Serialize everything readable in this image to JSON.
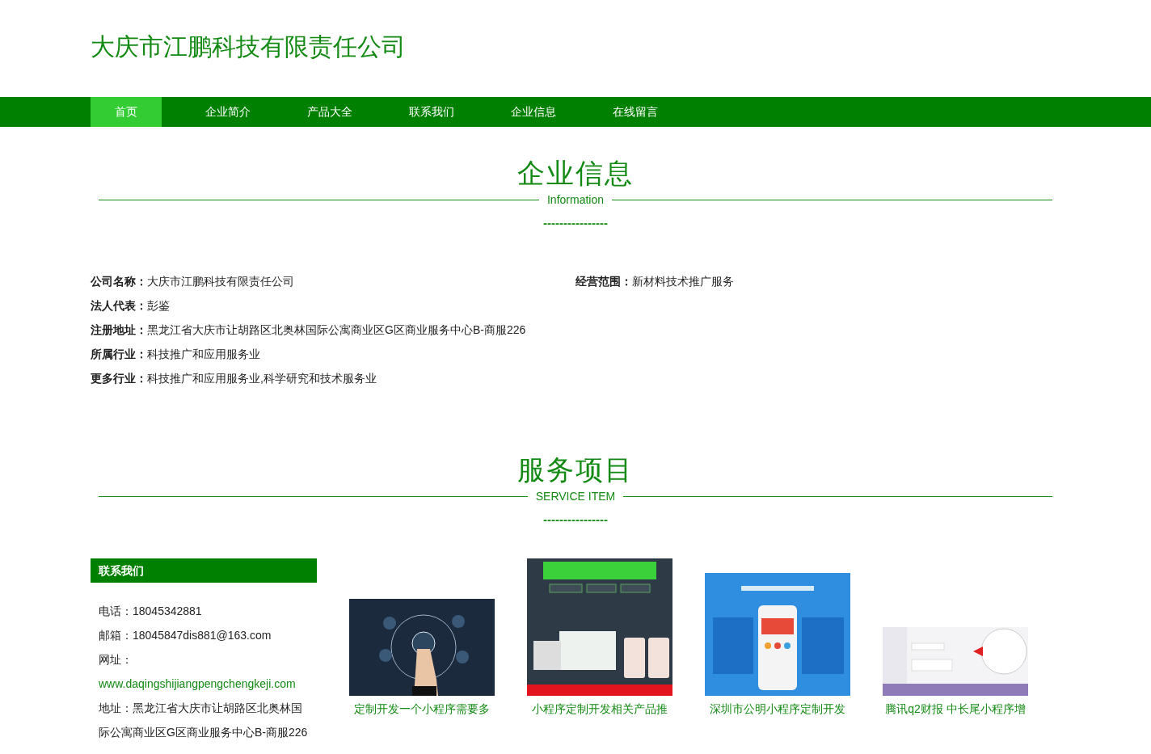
{
  "header": {
    "title": "大庆市江鹏科技有限责任公司"
  },
  "nav": [
    {
      "label": "首页",
      "selected": true
    },
    {
      "label": "企业简介",
      "selected": false
    },
    {
      "label": "产品大全",
      "selected": false
    },
    {
      "label": "联系我们",
      "selected": false
    },
    {
      "label": "企业信息",
      "selected": false
    },
    {
      "label": "在线留言",
      "selected": false
    }
  ],
  "info_section": {
    "title": "企业信息",
    "subtitle": "Information",
    "divider": "----------------",
    "left": [
      {
        "label": "公司名称：",
        "value": "大庆市江鹏科技有限责任公司"
      },
      {
        "label": "法人代表：",
        "value": "彭鉴"
      },
      {
        "label": "注册地址：",
        "value": "黑龙江省大庆市让胡路区北奥林国际公寓商业区G区商业服务中心B-商服226"
      },
      {
        "label": "所属行业：",
        "value": "科技推广和应用服务业"
      },
      {
        "label": "更多行业：",
        "value": "科技推广和应用服务业,科学研究和技术服务业"
      }
    ],
    "right": [
      {
        "label": "经营范围：",
        "value": "新材料技术推广服务"
      }
    ]
  },
  "service_section": {
    "title": "服务项目",
    "subtitle": "SERVICE ITEM",
    "divider": "----------------"
  },
  "contact": {
    "title": "联系我们",
    "lines": [
      {
        "kind": "text",
        "text": "电话：18045342881"
      },
      {
        "kind": "text",
        "text": "邮箱：18045847dis881@163.com"
      },
      {
        "kind": "text",
        "text": "网址："
      },
      {
        "kind": "link",
        "text": "www.daqingshijiangpengchengkeji.com"
      },
      {
        "kind": "text",
        "text": "地址：黑龙江省大庆市让胡路区北奥林国际公寓商业区G区商业服务中心B-商服226"
      }
    ]
  },
  "products": [
    {
      "kind": "picture",
      "caption": "定制开发一个小程序需要多"
    },
    {
      "kind": "picture",
      "caption": "小程序定制开发相关产品推"
    },
    {
      "kind": "picture",
      "caption": "深圳市公明小程序定制开发"
    },
    {
      "kind": "picture",
      "caption": "腾讯q2财报 中长尾小程序增"
    }
  ]
}
